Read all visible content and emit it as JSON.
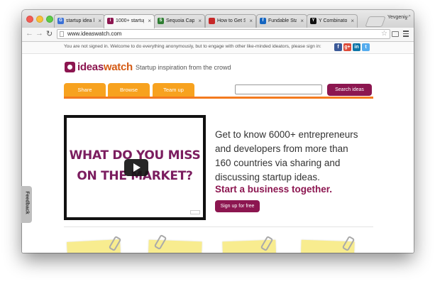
{
  "browser": {
    "tabs": [
      {
        "label": "startup idea li",
        "favicon": "G",
        "favicon_color": "#3a70d6"
      },
      {
        "label": "1000+ startup",
        "favicon": "i",
        "favicon_color": "#8c1650"
      },
      {
        "label": "Sequoia Capital",
        "favicon": "S",
        "favicon_color": "#2e7d32"
      },
      {
        "label": "How to Get Sta",
        "favicon": "",
        "favicon_color": "#c62828"
      },
      {
        "label": "Fundable Start",
        "favicon": "f",
        "favicon_color": "#1565c0"
      },
      {
        "label": "Y Combinator",
        "favicon": "Y",
        "favicon_color": "#111111"
      }
    ],
    "user_name": "Yevgeniy",
    "url": "www.ideaswatch.com"
  },
  "notice": {
    "text": "You are not signed in. Welcome to do everything anonymously, but to engage with other like-minded ideators, please sign in:",
    "social": [
      "f",
      "g+",
      "in",
      "t"
    ]
  },
  "site": {
    "logo_part1": "ideas",
    "logo_part2": "watch",
    "tagline": "Startup inspiration from the crowd",
    "nav": [
      "Share",
      "Browse",
      "Team up"
    ],
    "search_button": "Search ideas",
    "video_line1": "WHAT DO YOU MISS",
    "video_line2": "ON THE MARKET?",
    "headline": [
      "Get to know 6000+ entrepreneurs",
      "and developers from more than",
      "160 countries via sharing and",
      "discussing startup ideas."
    ],
    "cta": "Start a business together.",
    "signup_button": "Sign up for free",
    "feedback": "Feedback"
  },
  "colors": {
    "brand_purple": "#8c1650",
    "brand_orange": "#f7a21f",
    "accent_orange": "#f37a1f"
  }
}
